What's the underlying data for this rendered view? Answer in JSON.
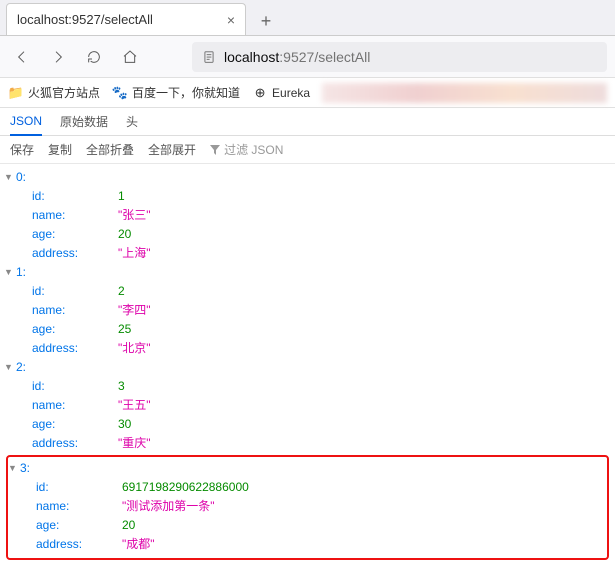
{
  "browser": {
    "tab_title": "localhost:9527/selectAll",
    "url_host": "localhost",
    "url_port": ":9527",
    "url_path": "/selectAll"
  },
  "bookmarks": [
    {
      "icon": "📁",
      "label": "火狐官方站点"
    },
    {
      "icon": "🐾",
      "label": "百度一下，你就知道"
    },
    {
      "icon": "⊕",
      "label": "Eureka"
    }
  ],
  "jsonViewer": {
    "tabs": [
      "JSON",
      "原始数据",
      "头"
    ],
    "activeTab": "JSON",
    "toolbar": [
      "保存",
      "复制",
      "全部折叠",
      "全部展开"
    ],
    "filterPlaceholder": "过滤 JSON"
  },
  "records": [
    {
      "id": 1,
      "name": "张三",
      "age": 20,
      "address": "上海"
    },
    {
      "id": 2,
      "name": "李四",
      "age": 25,
      "address": "北京"
    },
    {
      "id": 3,
      "name": "王五",
      "age": 30,
      "address": "重庆"
    },
    {
      "id": 6917198290622886000,
      "name": "测试添加第一条",
      "age": 20,
      "address": "成都"
    }
  ],
  "highlightIndex": 3
}
